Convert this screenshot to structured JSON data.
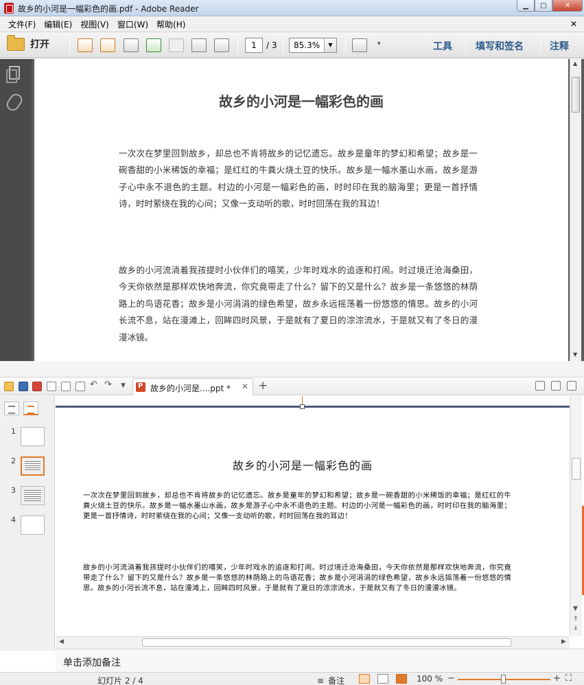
{
  "reader": {
    "window_title": "故乡的小河是一幅彩色的画.pdf - Adobe Reader",
    "menu": [
      "文件(F)",
      "编辑(E)",
      "视图(V)",
      "窗口(W)",
      "帮助(H)"
    ],
    "open_label": "打开",
    "page_current": "1",
    "page_total": "/ 3",
    "zoom": "85.3%",
    "right_tools": [
      "工具",
      "填写和签名",
      "注释"
    ],
    "doc_title": "故乡的小河是一幅彩色的画",
    "paragraphs": [
      "一次次在梦里回到故乡，却总也不肯将故乡的记忆遗忘。故乡是童年的梦幻和希望；故乡是一碗香甜的小米稀饭的幸福；是红红的牛粪火烧土豆的快乐。故乡是一幅水墨山水画，故乡是游子心中永不退色的主题。村边的小河是一幅彩色的画，时时印在我的脑海里；更是一首抒情诗，时时萦绕在我的心间；又像一支动听的歌，时时回荡在我的耳边！",
      "故乡的小河流淌着我孩提时小伙伴们的嘻笑，少年时戏水的追逐和打闹。时过境迁沧海桑田，今天你依然是那样欢快地奔流，你究竟带走了什么？留下的又是什么？故乡是一条悠悠的林荫路上的鸟语花香；故乡是小河涓涓的绿色希望，故乡永远摇荡着一份悠悠的情思。故乡的小河长流不息，站在漫滩上，回眸四时风景，于是就有了夏日的淙淙流水，于是就又有了冬日的漫漫冰镜。"
    ]
  },
  "wps": {
    "tab_name": "故乡的小河是....ppt *",
    "slide_numbers": [
      "1",
      "2",
      "3",
      "4"
    ],
    "slide_title": "故乡的小河是一幅彩色的画",
    "paragraphs": [
      "一次次在梦里回到故乡，却总也不肯将故乡的记忆遗忘。故乡是童年的梦幻和希望；故乡是一碗香甜的小米稀饭的幸福；是红红的牛粪火烧土豆的快乐。故乡是一幅水墨山水画，故乡是游子心中永不退色的主题。村边的小河是一幅彩色的画，时时印在我的脑海里；更是一首抒情诗，时时萦绕在我的心间；又像一支动听的歌，时时回荡在我的耳边！",
      "故乡的小河流淌着我孩提时小伙伴们的嘻笑，少年时戏水的追逐和打闹。时过境迁沧海桑田，今天你依然是那样欢快地奔流，你究竟带走了什么？留下的又是什么？故乡是一条悠悠的林荫路上的鸟语花香；故乡是小河涓涓的绿色希望，故乡永远摇荡着一份悠悠的情思。故乡的小河长流不息，站在漫滩上，回眸四时风景，于是就有了夏日的淙淙流水，于是就又有了冬日的漫漫冰镜。"
    ],
    "notes_placeholder": "单击添加备注",
    "status_slide": "幻灯片 2 / 4",
    "status_notes": "备注",
    "status_zoom": "100 %"
  }
}
